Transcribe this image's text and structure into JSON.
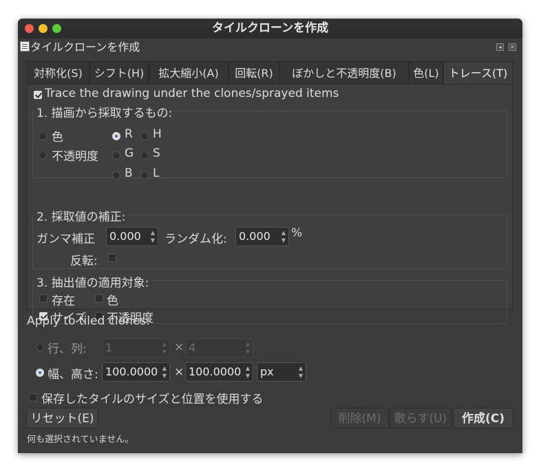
{
  "window": {
    "title": "タイルクローンを作成",
    "traffic_lights": [
      "#ee5c54",
      "#f5bd2e",
      "#5fc83f"
    ]
  },
  "dock": {
    "title": "タイルクローンを作成",
    "btn_iconify": "◂",
    "btn_close": "✕"
  },
  "tabs": [
    {
      "label": "対称化(S)"
    },
    {
      "label": "シフト(H)"
    },
    {
      "label": "拡大縮小(A)"
    },
    {
      "label": "回転(R)"
    },
    {
      "label": "ぼかしと不透明度(B)"
    },
    {
      "label": "色(L)"
    },
    {
      "label": "トレース(T)"
    }
  ],
  "trace": {
    "enable_label": "Trace the drawing under the clones/sprayed items",
    "enable_checked": true,
    "pick": {
      "title": "1. 描画から採取するもの:",
      "options": {
        "color": "色",
        "opacity": "不透明度",
        "r": "R",
        "g": "G",
        "b": "B",
        "h": "H",
        "s": "S",
        "l": "L"
      },
      "selected": "R"
    },
    "tweak": {
      "title": "2. 採取値の補正:",
      "gamma_label": "ガンマ補正",
      "gamma_value": "0.000",
      "random_label": "ランダム化:",
      "random_value": "0.000",
      "percent": "%",
      "invert_label": "反転:",
      "invert_checked": false
    },
    "apply": {
      "title": "3. 抽出値の適用対象:",
      "presence": "存在",
      "color": "色",
      "size": "サイズ",
      "opacity": "不透明度",
      "size_checked": true
    }
  },
  "tiled": {
    "heading": "Apply to tiled clones:",
    "rows_cols_label": "行、列:",
    "rows_value": "1",
    "cols_value": "4",
    "times": "×",
    "wh_label": "幅、高さ:",
    "width_value": "100.0000",
    "height_value": "100.0000",
    "unit": "px",
    "selected": "width_height",
    "remember_label": "保存したタイルのサイズと位置を使用する",
    "remember_checked": false
  },
  "buttons": {
    "reset": "リセット(E)",
    "remove": "削除(M)",
    "unclump": "散らす(U)",
    "create": "作成(C)"
  },
  "status": "何も選択されていません。"
}
